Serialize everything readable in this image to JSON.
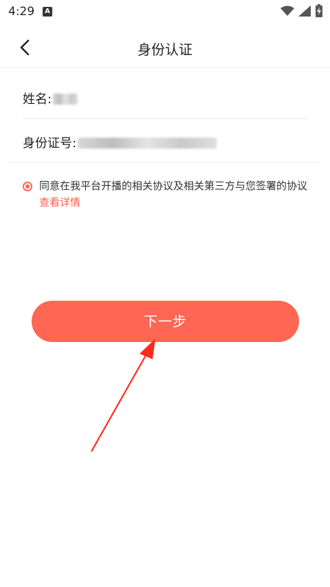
{
  "status_bar": {
    "time": "4:29",
    "notification_icon": "a-icon",
    "wifi_icon": "wifi-icon",
    "signal_icon": "signal-icon",
    "battery_icon": "battery-charging-icon"
  },
  "header": {
    "title": "身份认证",
    "back_icon": "chevron-left-icon"
  },
  "form": {
    "name_label": "姓名:",
    "id_label": "身份证号:"
  },
  "agreement": {
    "text": "同意在我平台开播的相关协议及相关第三方与您签署的协议",
    "link": "查看详情"
  },
  "next_button": "下一步",
  "colors": {
    "accent": "#ff6653",
    "link": "#ff5f4e"
  }
}
